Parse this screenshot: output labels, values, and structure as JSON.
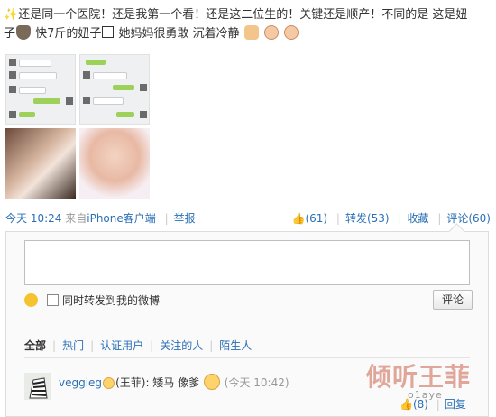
{
  "post": {
    "text_line1": "还是同一个医院！还是我第一个看！还是这二位生的！关键还是顺产！不同的是 这是妞",
    "text_line2_a": "子",
    "text_line2_b": " 快7斤的妞子",
    "text_line2_c": " 她妈妈很勇敢 沉着冷静"
  },
  "meta": {
    "time": "今天 10:24",
    "source_prefix": "来自",
    "source_link": "iPhone客户端",
    "report": "举报",
    "like": "(61)",
    "forward": "转发(53)",
    "favorite": "收藏",
    "comment": "评论(60)"
  },
  "comment_box": {
    "checkbox_label": "同时转发到我的微博",
    "submit_label": "评论"
  },
  "tabs": [
    "全部",
    "热门",
    "认证用户",
    "关注的人",
    "陌生人"
  ],
  "comment": {
    "user": "veggieg",
    "mention": "(王菲)",
    "text": ": 矮马 像爹",
    "time": "(今天 10:42)",
    "like": "(8)",
    "reply": "回复"
  },
  "watermark": {
    "main": "倾听王菲",
    "sub": "o1aye"
  }
}
